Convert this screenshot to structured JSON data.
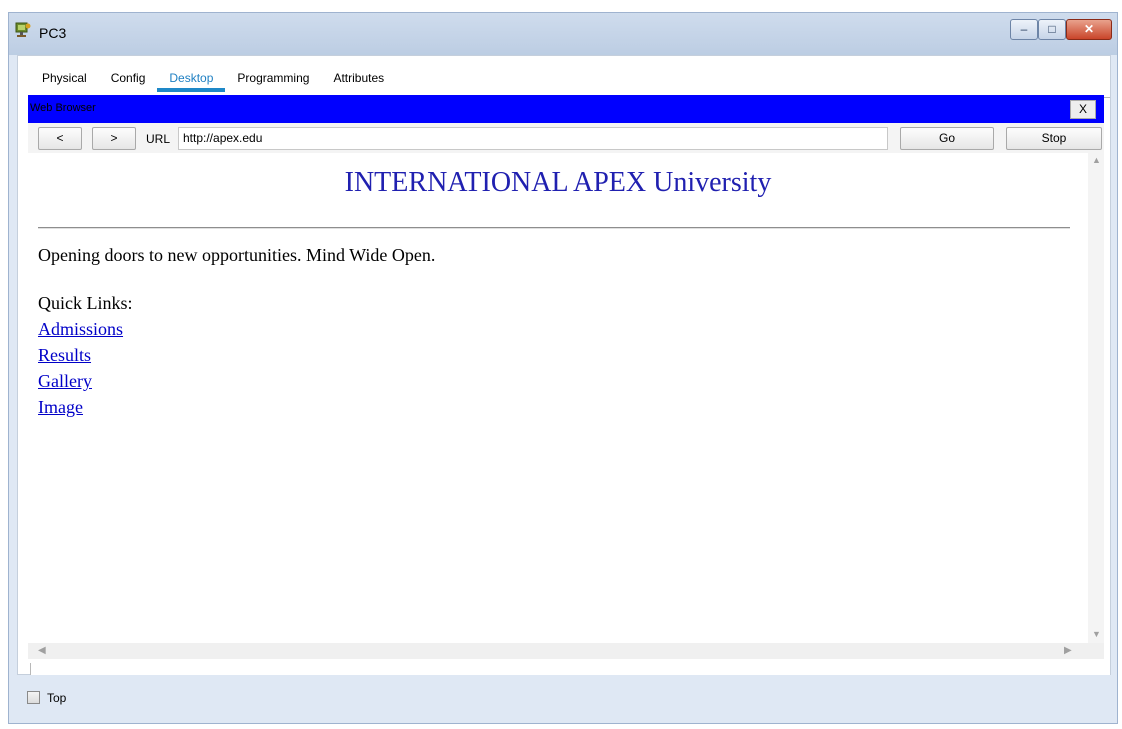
{
  "window": {
    "title": "PC3",
    "icon": "pc-icon",
    "controls": {
      "minimize": "–",
      "maximize": "□",
      "close": "✕"
    }
  },
  "tabs": [
    {
      "label": "Physical",
      "active": false
    },
    {
      "label": "Config",
      "active": false
    },
    {
      "label": "Desktop",
      "active": true
    },
    {
      "label": "Programming",
      "active": false
    },
    {
      "label": "Attributes",
      "active": false
    }
  ],
  "browser": {
    "title": "Web Browser",
    "close_label": "X",
    "back_label": "<",
    "forward_label": ">",
    "url_label": "URL",
    "url_value": "http://apex.edu",
    "go_label": "Go",
    "stop_label": "Stop",
    "header_color": "#0000ff"
  },
  "page": {
    "heading": "INTERNATIONAL APEX University",
    "tagline": "Opening doors to new opportunities. Mind Wide Open.",
    "links_heading": "Quick Links:",
    "links": [
      "Admissions",
      "Results",
      "Gallery",
      "Image"
    ]
  },
  "scrollbars": {
    "up": "▲",
    "down": "▼",
    "left": "◀",
    "right": "▶"
  },
  "footer": {
    "top_label": "Top",
    "top_checked": false
  }
}
